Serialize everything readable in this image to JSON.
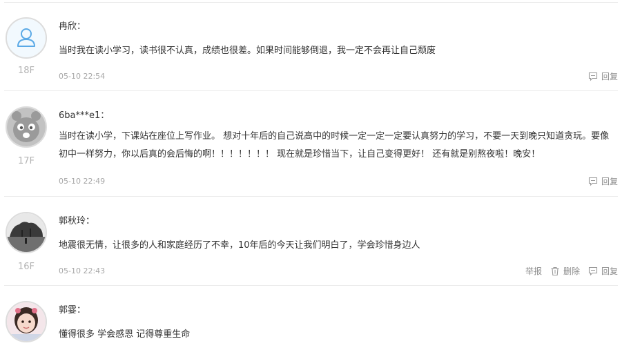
{
  "comments": [
    {
      "user": "冉欣：",
      "text": "当时我在读小学习，读书很不认真，成绩也很差。如果时间能够倒退，我一定不会再让自己颓废",
      "time": "05-10 22:54",
      "floor": "18F",
      "avatar_icon": "default-user-icon",
      "actions": {
        "reply": "回复"
      }
    },
    {
      "user": "6ba***e1：",
      "text": "当时在读小学，下课站在座位上写作业。 想对十年后的自己说高中的时候一定一定一定要认真努力的学习，不要一天到晚只知道贪玩。要像初中一样努力，你以后真的会后悔的啊！！！！！！！ 现在就是珍惜当下，让自己变得更好！ 还有就是别熬夜啦！晚安！",
      "time": "05-10 22:49",
      "floor": "17F",
      "avatar_icon": "bear-avatar-icon",
      "actions": {
        "reply": "回复"
      }
    },
    {
      "user": "郭秋玲：",
      "text": "地震很无情，让很多的人和家庭经历了不幸，10年后的今天让我们明白了，学会珍惜身边人",
      "time": "05-10 22:43",
      "floor": "16F",
      "avatar_icon": "landscape-photo-avatar",
      "actions": {
        "report": "举报",
        "delete": "删除",
        "reply": "回复"
      }
    },
    {
      "user": "郭霎：",
      "text": "懂得很多 学会感恩 记得尊重生命",
      "avatar_icon": "child-photo-avatar"
    }
  ],
  "colors": {
    "text": "#333333",
    "muted": "#a6a6a6",
    "divider": "#ebebeb",
    "avatar_default": "#5aa9e6"
  }
}
